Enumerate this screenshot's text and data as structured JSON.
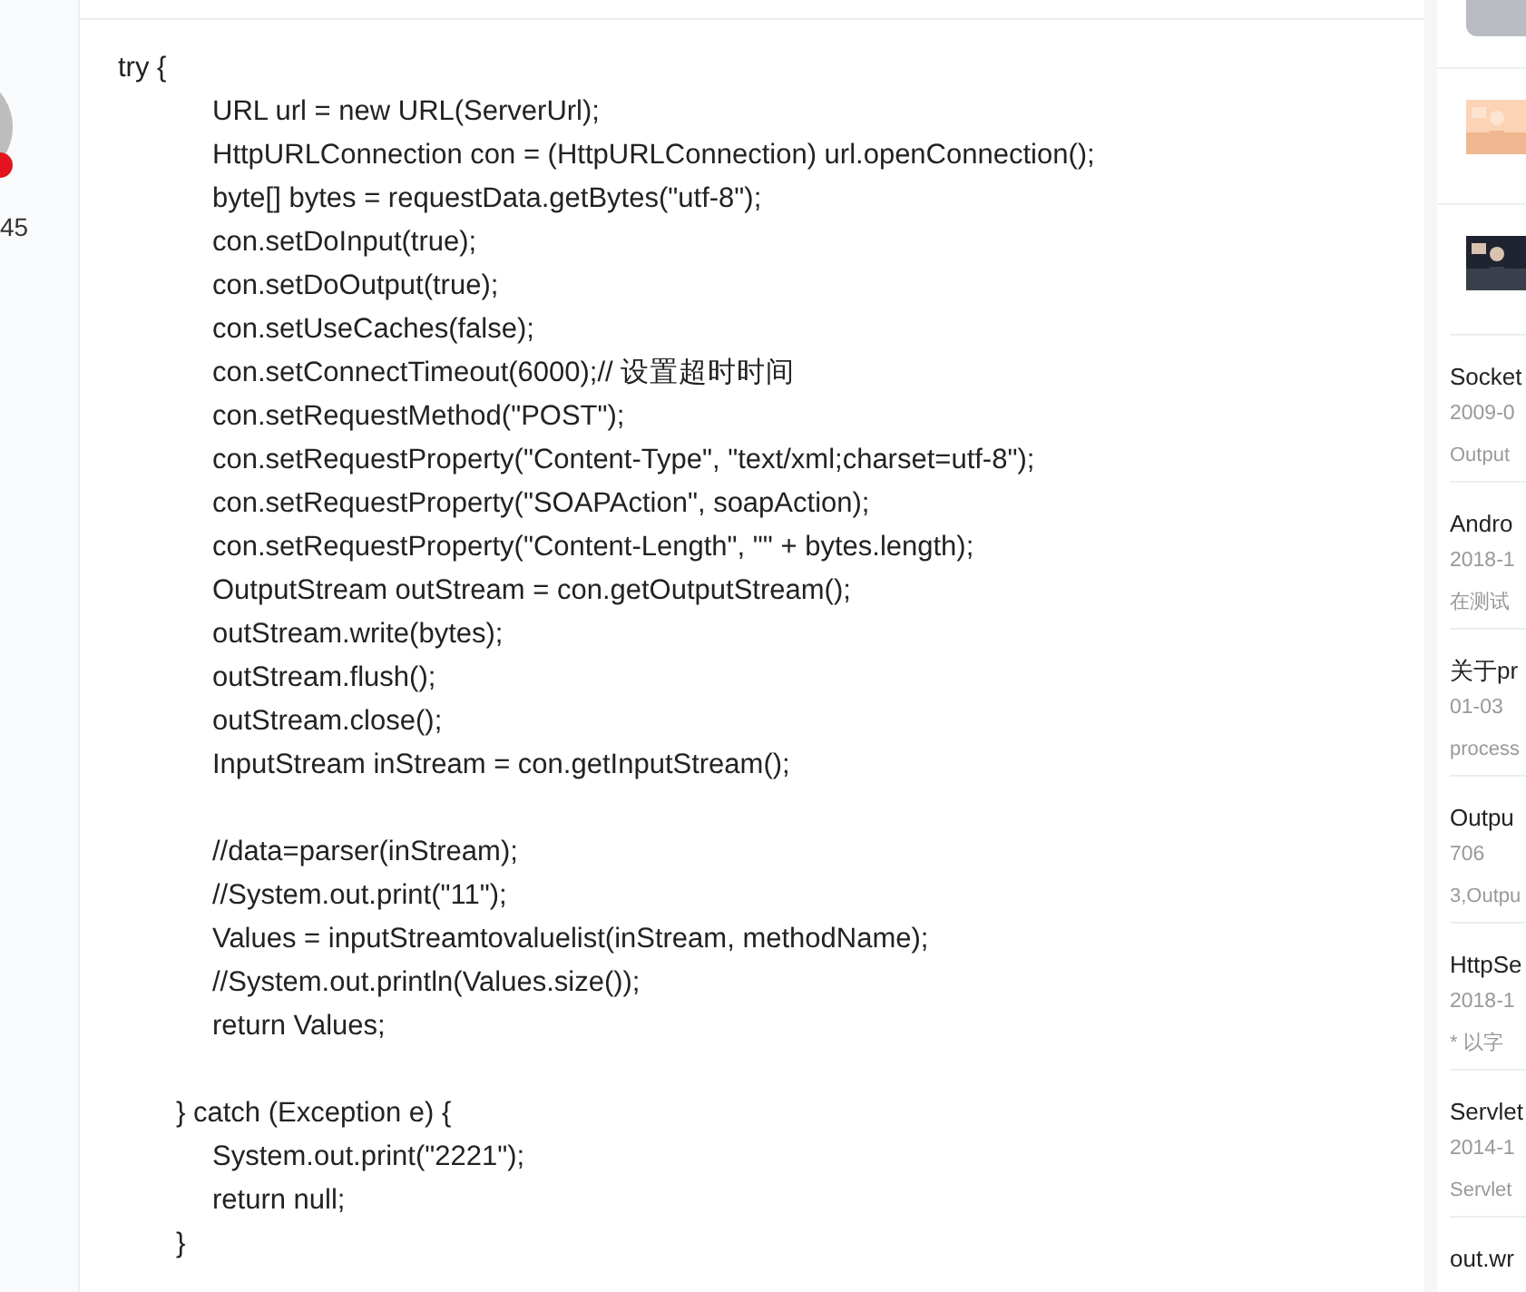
{
  "author": {
    "count": "45"
  },
  "code": {
    "lines": [
      {
        "kind": "top",
        "text": "try {"
      },
      {
        "kind": "body",
        "text": "URL url = new URL(ServerUrl);"
      },
      {
        "kind": "body",
        "text": "HttpURLConnection con = (HttpURLConnection) url.openConnection();"
      },
      {
        "kind": "body",
        "text": "byte[] bytes = requestData.getBytes(\"utf-8\");"
      },
      {
        "kind": "body",
        "text": "con.setDoInput(true);"
      },
      {
        "kind": "body",
        "text": "con.setDoOutput(true);"
      },
      {
        "kind": "body",
        "text": "con.setUseCaches(false);"
      },
      {
        "kind": "body",
        "text": "con.setConnectTimeout(6000);// 设置超时时间"
      },
      {
        "kind": "body",
        "text": "con.setRequestMethod(\"POST\");"
      },
      {
        "kind": "body",
        "text": "con.setRequestProperty(\"Content-Type\", \"text/xml;charset=utf-8\");"
      },
      {
        "kind": "body",
        "text": "con.setRequestProperty(\"SOAPAction\", soapAction);"
      },
      {
        "kind": "body",
        "text": "con.setRequestProperty(\"Content-Length\", \"\" + bytes.length);"
      },
      {
        "kind": "body",
        "text": "OutputStream outStream = con.getOutputStream();"
      },
      {
        "kind": "body",
        "text": "outStream.write(bytes);"
      },
      {
        "kind": "body",
        "text": "outStream.flush();"
      },
      {
        "kind": "body",
        "text": "outStream.close();"
      },
      {
        "kind": "body",
        "text": "InputStream inStream = con.getInputStream();"
      },
      {
        "kind": "blank"
      },
      {
        "kind": "body",
        "text": "//data=parser(inStream);"
      },
      {
        "kind": "body",
        "text": "//System.out.print(\"11\");"
      },
      {
        "kind": "body",
        "text": "Values = inputStreamtovaluelist(inStream, methodName);"
      },
      {
        "kind": "body",
        "text": "//System.out.println(Values.size());"
      },
      {
        "kind": "body",
        "text": "return Values;"
      },
      {
        "kind": "blank"
      },
      {
        "kind": "clause",
        "text": "} catch (Exception e) {"
      },
      {
        "kind": "body",
        "text": "System.out.print(\"2221\");"
      },
      {
        "kind": "body",
        "text": "return null;"
      },
      {
        "kind": "clause",
        "text": "}"
      }
    ]
  },
  "sidebar": {
    "articles": [
      {
        "title": "Socket",
        "date": "2009-0",
        "snippet": "Output"
      },
      {
        "title": "Andro",
        "date": "2018-1",
        "snippet": "在测试"
      },
      {
        "title": "关于pr",
        "date": "01-03",
        "snippet": "process"
      },
      {
        "title": "Outpu",
        "date": "706",
        "snippet": "3,Outpu"
      },
      {
        "title": "HttpSe",
        "date": "2018-1",
        "snippet": "* 以字"
      },
      {
        "title": "Servlet",
        "date": "2014-1",
        "snippet": "Servlet"
      },
      {
        "title": "out.wr"
      }
    ]
  }
}
